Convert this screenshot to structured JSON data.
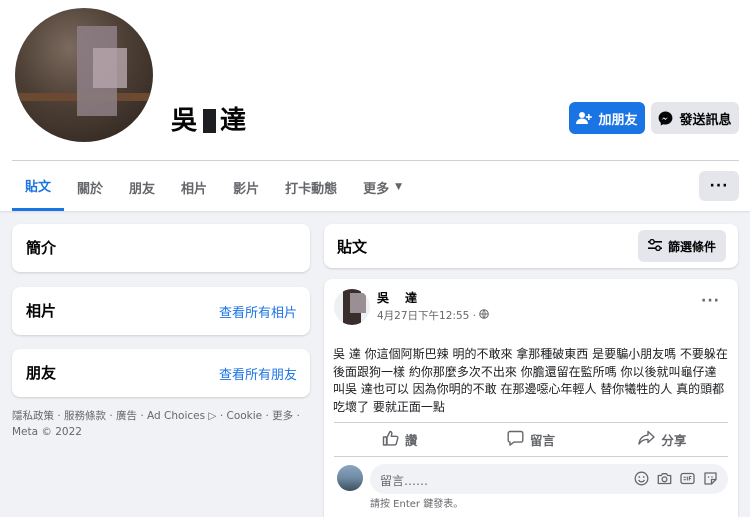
{
  "profile": {
    "name_part1": "吳",
    "name_part2": "達"
  },
  "header_buttons": {
    "add_friend": "加朋友",
    "send_message": "發送訊息"
  },
  "tabs": [
    {
      "label": "貼文"
    },
    {
      "label": "關於"
    },
    {
      "label": "朋友"
    },
    {
      "label": "相片"
    },
    {
      "label": "影片"
    },
    {
      "label": "打卡動態"
    },
    {
      "label": "更多"
    }
  ],
  "more_menu": "···",
  "left_cards": {
    "intro": {
      "title": "簡介"
    },
    "photos": {
      "title": "相片",
      "link": "查看所有相片"
    },
    "friends": {
      "title": "朋友",
      "link": "查看所有朋友"
    }
  },
  "footer": {
    "line1": "隱私政策 · 服務條款 · 廣告 · Ad Choices ▷ · Cookie · 更多 ·",
    "line2": "Meta © 2022"
  },
  "posts_section": {
    "title": "貼文",
    "filter_label": "篩選條件"
  },
  "post": {
    "author": "吳　達",
    "time": "4月27日下午12:55 ·",
    "menu": "···",
    "text": "吳 達 你這個阿斯巴辣 明的不敢來 拿那種破東西 是要騙小朋友嗎 不要躲在後面跟狗一樣 約你那麼多次不出來 你膽還留在監所嗎 你以後就叫龜仔達 叫吳 達也可以 因為你明的不敢 在那邊噁心年輕人 替你犧牲的人 真的頭都吃壞了 要就正面一點",
    "actions": {
      "like": "讚",
      "comment": "留言",
      "share": "分享"
    },
    "comment_placeholder": "留言……",
    "enter_hint": "請按 Enter 鍵發表。"
  },
  "colors": {
    "accent": "#1b74e4",
    "background": "#f0f2f5",
    "muted_text": "#65676b"
  }
}
